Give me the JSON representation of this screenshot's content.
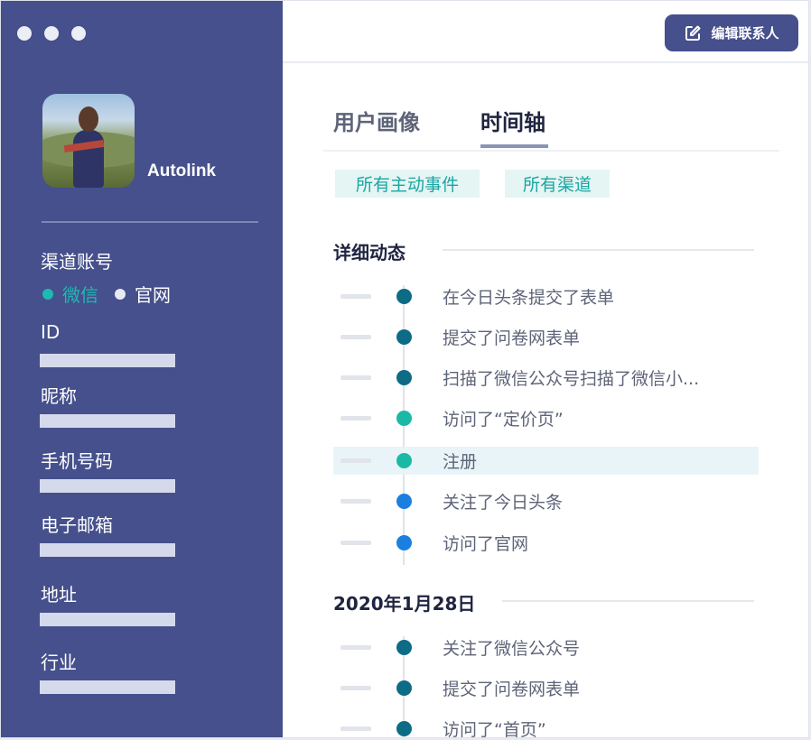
{
  "header": {
    "edit_contact_label": "编辑联系人"
  },
  "profile": {
    "username": "Autolink",
    "channel_account_label": "渠道账号",
    "channels": [
      {
        "label": "微信",
        "active": true,
        "color": "#1fb9b1"
      },
      {
        "label": "官网",
        "active": false,
        "color": "#e8eaf3"
      }
    ],
    "fields": [
      "ID",
      "昵称",
      "手机号码",
      "电子邮箱",
      "地址",
      "行业"
    ]
  },
  "tabs": [
    {
      "label": "用户画像",
      "active": false
    },
    {
      "label": "时间轴",
      "active": true
    }
  ],
  "filters": [
    "所有主动事件",
    "所有渠道"
  ],
  "sections": [
    {
      "title": "详细动态",
      "events": [
        {
          "text": "在今日头条提交了表单",
          "color": "#0d6b86"
        },
        {
          "text": "提交了问卷网表单",
          "color": "#0d6b86"
        },
        {
          "text": "扫描了微信公众号扫描了微信小...",
          "color": "#0d6b86"
        },
        {
          "text": "访问了“定价页”",
          "color": "#1ab9a6"
        },
        {
          "text": "注册",
          "color": "#1ab9a6",
          "highlighted": true
        },
        {
          "text": "关注了今日头条",
          "color": "#1a7fe0"
        },
        {
          "text": "访问了官网",
          "color": "#1a7fe0"
        }
      ]
    },
    {
      "title": "2020年1月28日",
      "events": [
        {
          "text": "关注了微信公众号",
          "color": "#0d6b86"
        },
        {
          "text": "提交了问卷网表单",
          "color": "#0d6b86"
        },
        {
          "text": "访问了“首页”",
          "color": "#0d6b86"
        }
      ]
    }
  ],
  "colors": {
    "sidebar": "#45508c",
    "accent_teal": "#1aa6a2",
    "tab_active": "#1f2440",
    "tab_inactive": "#5e6478"
  }
}
